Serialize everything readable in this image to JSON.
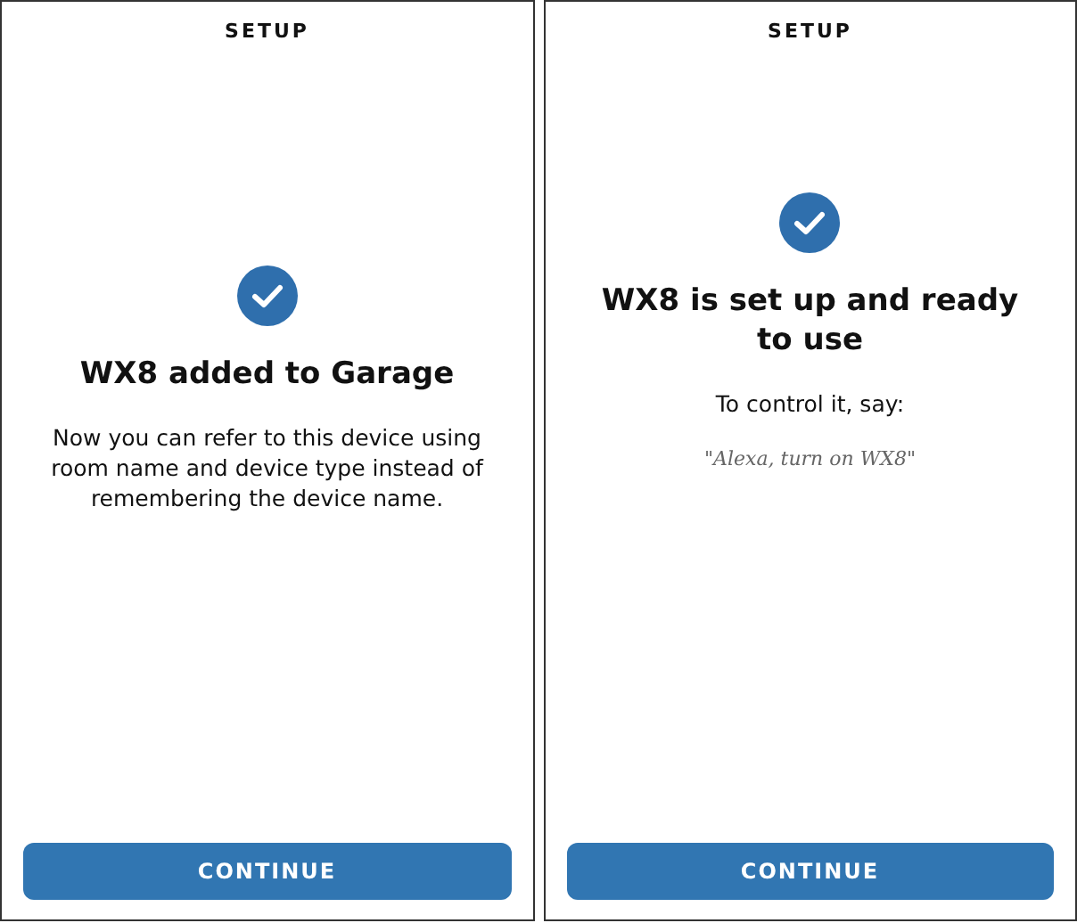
{
  "screens": [
    {
      "header": "SETUP",
      "kind": "added",
      "title": "WX8 added to Garage",
      "body": "Now you can refer to this device using room name and device type instead of remembering the device name.",
      "button": "CONTINUE"
    },
    {
      "header": "SETUP",
      "kind": "ready",
      "title": "WX8 is set up and ready to use",
      "body": "To control it, say:",
      "quote": "\"Alexa, turn on WX8\"",
      "button": "CONTINUE"
    }
  ]
}
